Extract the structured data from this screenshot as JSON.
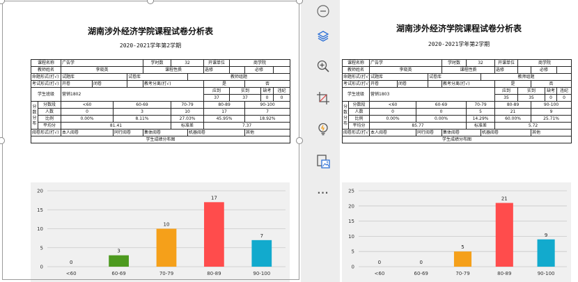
{
  "documents": [
    {
      "title": "湖南涉外经济学院课程试卷分析表",
      "subtitle": "2020-2021学年第2学期",
      "info": {
        "course_name_label": "课程名称",
        "course_name": "广告学",
        "hours_label": "学时数",
        "hours": "32",
        "dept_label": "开课单位",
        "dept": "商学院",
        "teacher_label": "教师姓名",
        "teacher": "李晓英",
        "nature_label": "课程性质",
        "elective_label": "选修",
        "required_label": "必修",
        "exam_method_label": "命题形式(打√)",
        "opt_bank": "试题库",
        "opt_paper_bank": "试卷库",
        "opt_teacher": "教师组题",
        "exam_form_label": "考试形式(打√)",
        "opt_open": "开卷",
        "opt_closed": "闭卷",
        "ab_label": "教考分离(打√)",
        "yes_label": "是",
        "no_label": "否",
        "class_label": "学生班级",
        "class": "营销1802",
        "should_label": "应到",
        "actual_label": "实到",
        "absent_label": "缺考",
        "cheat_label": "违纪",
        "should": "37",
        "actual": "37",
        "absent": "0",
        "cheat": "0"
      },
      "dist": {
        "side_label": [
          "分",
          "数",
          "分",
          "布"
        ],
        "band_label": "分数段",
        "bands": [
          "<60",
          "60-69",
          "70-79",
          "80-89",
          "90-100"
        ],
        "count_label": "人数",
        "counts": [
          "0",
          "3",
          "10",
          "17",
          "7"
        ],
        "ratio_label": "比例",
        "ratios": [
          "0.00%",
          "8.11%",
          "27.03%",
          "45.95%",
          "18.92%"
        ],
        "avg_label": "平均分",
        "avg": "81.41",
        "std_label": "标准差",
        "std": "7.37"
      },
      "review": {
        "label": "阅卷形式(打√)",
        "opt_self": "本人阅卷",
        "opt_peer": "同行阅卷",
        "opt_group": "集体阅卷",
        "opt_machine": "机器阅卷",
        "opt_other": "其他"
      },
      "chart_title": "学生成绩分布图",
      "chart_data": {
        "type": "bar",
        "categories": [
          "<60",
          "60-69",
          "70-79",
          "80-89",
          "90-100"
        ],
        "values": [
          0,
          3,
          10,
          17,
          7
        ],
        "ylim": [
          0,
          20
        ],
        "yticks": [
          0,
          5,
          10,
          15,
          20
        ],
        "bar_colors": [
          "#7f7f7f",
          "#4d9a1f",
          "#f5a01a",
          "#ff4c4c",
          "#12aacd"
        ],
        "grid": true
      }
    },
    {
      "title": "湖南涉外经济学院课程试卷分析表",
      "subtitle": "2020-2021学年第2学期",
      "info": {
        "course_name_label": "课程名称",
        "course_name": "广告学",
        "hours_label": "学时数",
        "hours": "32",
        "dept_label": "开课单位",
        "dept": "商学院",
        "teacher_label": "教师姓名",
        "teacher": "李晓英",
        "nature_label": "课程性质",
        "elective_label": "选修",
        "required_label": "必修",
        "exam_method_label": "命题形式(打√)",
        "opt_bank": "试题库",
        "opt_paper_bank": "试卷库",
        "opt_teacher": "教师组题",
        "exam_form_label": "考试形式(打√)",
        "opt_open": "开卷",
        "opt_closed": "闭卷",
        "ab_label": "教考分离(打√)",
        "yes_label": "是",
        "no_label": "否",
        "class_label": "学生班级",
        "class": "营销1803",
        "should_label": "应到",
        "actual_label": "实到",
        "absent_label": "缺考",
        "cheat_label": "违纪",
        "should": "35",
        "actual": "35",
        "absent": "0",
        "cheat": "0"
      },
      "dist": {
        "side_label": [
          "分",
          "数",
          "分",
          "布"
        ],
        "band_label": "分数段",
        "bands": [
          "<60",
          "60-69",
          "70-79",
          "80-89",
          "90-100"
        ],
        "count_label": "人数",
        "counts": [
          "0",
          "0",
          "5",
          "21",
          "9"
        ],
        "ratio_label": "比例",
        "ratios": [
          "0.00%",
          "0.00%",
          "14.29%",
          "60.00%",
          "25.71%"
        ],
        "avg_label": "平均分",
        "avg": "85.77",
        "std_label": "标准差",
        "std": "5.72"
      },
      "review": {
        "label": "阅卷形式(打√)",
        "opt_self": "本人阅卷",
        "opt_peer": "同行阅卷",
        "opt_group": "集体阅卷",
        "opt_machine": "机器阅卷",
        "opt_other": "其他"
      },
      "chart_title": "学生成绩分布图",
      "chart_data": {
        "type": "bar",
        "categories": [
          "<60",
          "60-69",
          "70-79",
          "80-89",
          "90-100"
        ],
        "values": [
          0,
          0,
          5,
          21,
          9
        ],
        "ylim": [
          0,
          25
        ],
        "yticks": [
          0,
          5,
          10,
          15,
          20,
          25
        ],
        "bar_colors": [
          "#7f7f7f",
          "#4d9a1f",
          "#f5a01a",
          "#ff4c4c",
          "#12aacd"
        ],
        "grid": true
      }
    }
  ],
  "toolbar": {
    "icons": [
      "collapse-icon",
      "layers-icon",
      "zoom-in-icon",
      "crop-icon",
      "lightbulb-icon",
      "image-convert-icon",
      "more-icon"
    ],
    "more_label": "···"
  },
  "colors": {
    "accent": "#2b6fd6",
    "toolbar_gray": "#666666"
  }
}
